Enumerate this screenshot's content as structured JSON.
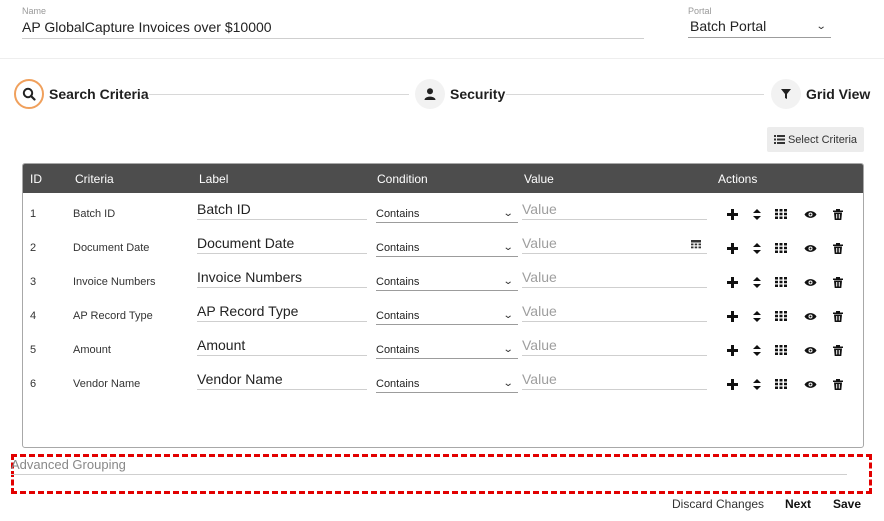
{
  "name_field": {
    "caption": "Name",
    "value": "AP GlobalCapture Invoices over $10000"
  },
  "portal_field": {
    "caption": "Portal",
    "value": "Batch Portal"
  },
  "steps": [
    {
      "label": "Search Criteria",
      "icon": "search-icon",
      "active": true
    },
    {
      "label": "Security",
      "icon": "user-icon",
      "active": false
    },
    {
      "label": "Grid View",
      "icon": "filter-icon",
      "active": false
    }
  ],
  "select_criteria_label": "Select Criteria",
  "grid": {
    "headers": {
      "id": "ID",
      "criteria": "Criteria",
      "label": "Label",
      "condition": "Condition",
      "value": "Value",
      "actions": "Actions"
    },
    "rows": [
      {
        "id": "1",
        "criteria": "Batch ID",
        "label": "Batch ID",
        "condition": "Contains",
        "value_placeholder": "Value",
        "has_calendar": false
      },
      {
        "id": "2",
        "criteria": "Document Date",
        "label": "Document Date",
        "condition": "Contains",
        "value_placeholder": "Value",
        "has_calendar": true
      },
      {
        "id": "3",
        "criteria": "Invoice Numbers",
        "label": "Invoice Numbers",
        "condition": "Contains",
        "value_placeholder": "Value",
        "has_calendar": false
      },
      {
        "id": "4",
        "criteria": "AP Record Type",
        "label": "AP Record Type",
        "condition": "Contains",
        "value_placeholder": "Value",
        "has_calendar": false
      },
      {
        "id": "5",
        "criteria": "Amount",
        "label": "Amount",
        "condition": "Contains",
        "value_placeholder": "Value",
        "has_calendar": false
      },
      {
        "id": "6",
        "criteria": "Vendor Name",
        "label": "Vendor Name",
        "condition": "Contains",
        "value_placeholder": "Value",
        "has_calendar": false
      }
    ],
    "row_actions": [
      "add-icon",
      "sort-icon",
      "columns-icon",
      "eye-icon",
      "trash-icon"
    ]
  },
  "advanced_grouping_label": "Advanced Grouping",
  "footer": {
    "discard": "Discard Changes",
    "next": "Next",
    "save": "Save"
  },
  "colors": {
    "header_bg": "#4d4d4d",
    "active_step_ring": "#f0a05c",
    "highlight_dash": "#e20000"
  }
}
